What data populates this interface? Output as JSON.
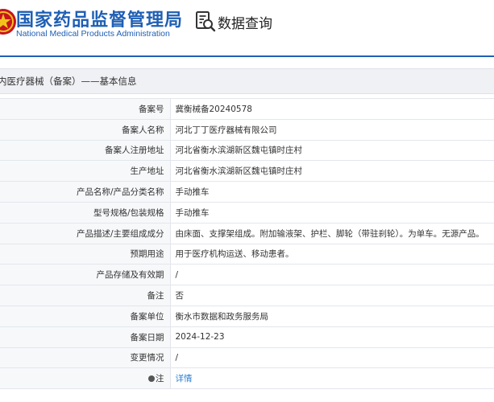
{
  "header": {
    "agency_name_cn": "国家药品监督管理局",
    "agency_name_en": "National Medical Products Administration",
    "query_title": "数据查询",
    "brand_color": "#1f5fb4",
    "emblem_icon": "national-emblem-icon",
    "query_icon": "document-search-icon"
  },
  "section": {
    "title": "内医疗器械（备案）——基本信息"
  },
  "details": {
    "rows": [
      {
        "label": "备案号",
        "value": "冀衡械备20240578"
      },
      {
        "label": "备案人名称",
        "value": "河北丁丁医疗器械有限公司"
      },
      {
        "label": "备案人注册地址",
        "value": "河北省衡水滨湖新区魏屯镇时庄村"
      },
      {
        "label": "生产地址",
        "value": "河北省衡水滨湖新区魏屯镇时庄村"
      },
      {
        "label": "产品名称/产品分类名称",
        "value": "手动推车"
      },
      {
        "label": "型号规格/包装规格",
        "value": "手动推车"
      },
      {
        "label": "产品描述/主要组成成分",
        "value": "由床面、支撑架组成。附加输液架、护栏、脚轮（带驻刹轮）。为单车。无源产品。"
      },
      {
        "label": "预期用途",
        "value": "用于医疗机构运送、移动患者。"
      },
      {
        "label": "产品存储及有效期",
        "value": "/"
      },
      {
        "label": "备注",
        "value": "否"
      },
      {
        "label": "备案单位",
        "value": "衡水市数据和政务服务局"
      },
      {
        "label": "备案日期",
        "value": "2024-12-23"
      },
      {
        "label": "变更情况",
        "value": "/"
      },
      {
        "label": "注",
        "value": "详情",
        "link_color": "#2f7fd1"
      }
    ]
  }
}
